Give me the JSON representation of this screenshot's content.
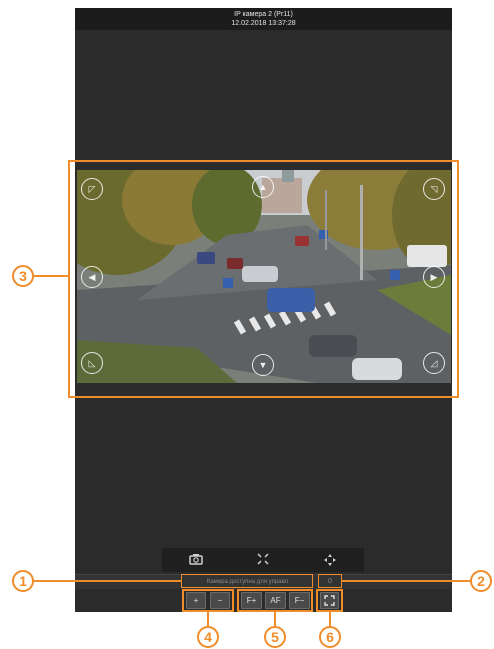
{
  "header": {
    "title": "IP камера 2 (Pr11)",
    "datetime": "12.02.2018 13:37:28"
  },
  "toolbar": {
    "snapshot_icon": "camera-icon",
    "center_icon": "crosshair-icon",
    "ptz_icon": "ptz-arrows-icon"
  },
  "status": {
    "message": "Камера доступна для управл",
    "counter": "0"
  },
  "controls": {
    "zoom_in": "+",
    "zoom_out": "−",
    "focus_plus": "F+",
    "autofocus": "AF",
    "focus_minus": "F−",
    "fullscreen": "fullscreen-icon"
  },
  "callouts": {
    "c1": "1",
    "c2": "2",
    "c3": "3",
    "c4": "4",
    "c5": "5",
    "c6": "6"
  },
  "colors": {
    "accent": "#f08c2a",
    "background": "#2b2b2b"
  }
}
